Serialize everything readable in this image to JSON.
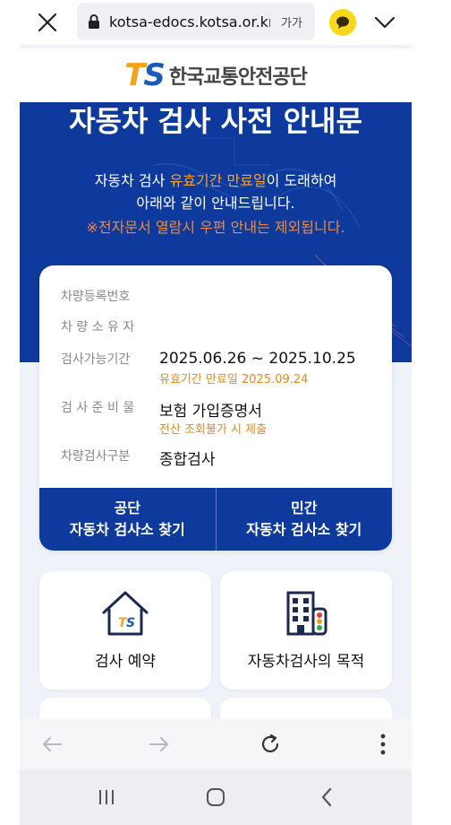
{
  "browser": {
    "url": "kotsa-edocs.kotsa.or.kr",
    "translate_label": "가가"
  },
  "header": {
    "logo_mark": "TS",
    "org_name": "한국교통안전공단"
  },
  "hero": {
    "title": "자동차 검사 사전 안내문",
    "line1_pre": "자동차 검사 ",
    "line1_highlight": "유효기간 만료일",
    "line1_post": "이 도래하여",
    "line2": "아래와 같이 안내드립니다.",
    "warning": "※전자문서 열람시 우편 안내는 제외됩니다."
  },
  "info": {
    "rows": [
      {
        "label": "차량등록번호",
        "value": "",
        "sub": ""
      },
      {
        "label": "차 량 소 유 자",
        "value": "",
        "sub": ""
      },
      {
        "label": "검사가능기간",
        "value": "2025.06.26 ~ 2025.10.25",
        "sub": "유효기간 만료일 2025.09.24"
      },
      {
        "label": "검 사 준 비 물",
        "value": "보험 가입증명서",
        "sub": "전산 조회불가 시 제출"
      },
      {
        "label": "차량검사구분",
        "value": "종합검사",
        "sub": ""
      }
    ],
    "buttons": [
      {
        "line1": "공단",
        "line2": "자동차 검사소 찾기"
      },
      {
        "line1": "민간",
        "line2": "자동차 검사소 찾기"
      }
    ]
  },
  "tiles": [
    {
      "label": "검사 예약",
      "icon": "house-ts-icon"
    },
    {
      "label": "자동차검사의 목적",
      "icon": "building-traffic-light-icon"
    }
  ],
  "colors": {
    "primary": "#0d3a9c",
    "accent": "#f2a21b",
    "warning": "#f08a3c",
    "sub_text": "#e5891c"
  }
}
